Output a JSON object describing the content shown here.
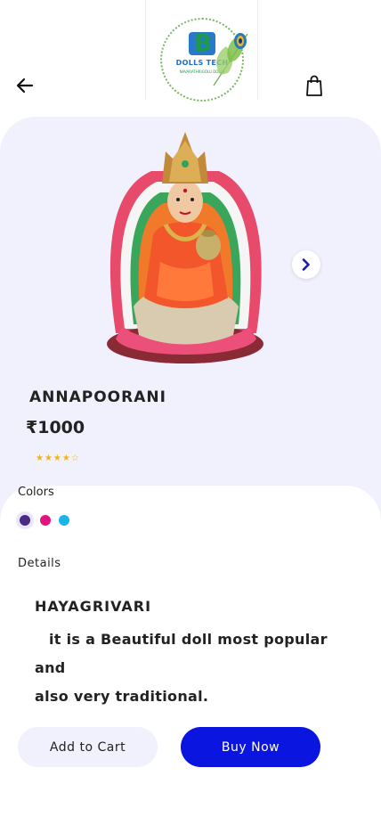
{
  "logo": {
    "title": "DOLLS TECH",
    "subtitle": "NAVARATHRIGOLU DOLLS",
    "icon": "B"
  },
  "header": {
    "back_icon": "arrow-left-icon",
    "cart_icon": "shopping-bag-icon"
  },
  "product": {
    "name": "ANNAPOORANI",
    "price": "₹1000",
    "rating_stars": "★★★★☆",
    "rating": 4,
    "next_icon": "chevron-right-icon"
  },
  "colors": {
    "label": "Colors",
    "options": [
      "#4a2a85",
      "#e0147c",
      "#1ab4e8"
    ],
    "selected_index": 0
  },
  "details": {
    "label": "Details",
    "title": "HAYAGRIVARI",
    "body_line1": "it is a Beautiful doll most popular and",
    "body_line2": "also very traditional."
  },
  "actions": {
    "add_to_cart": "Add to Cart",
    "buy_now": "Buy Now"
  },
  "theme": {
    "accent": "#0a15e0",
    "hero_bg": "#f1f0fd"
  }
}
